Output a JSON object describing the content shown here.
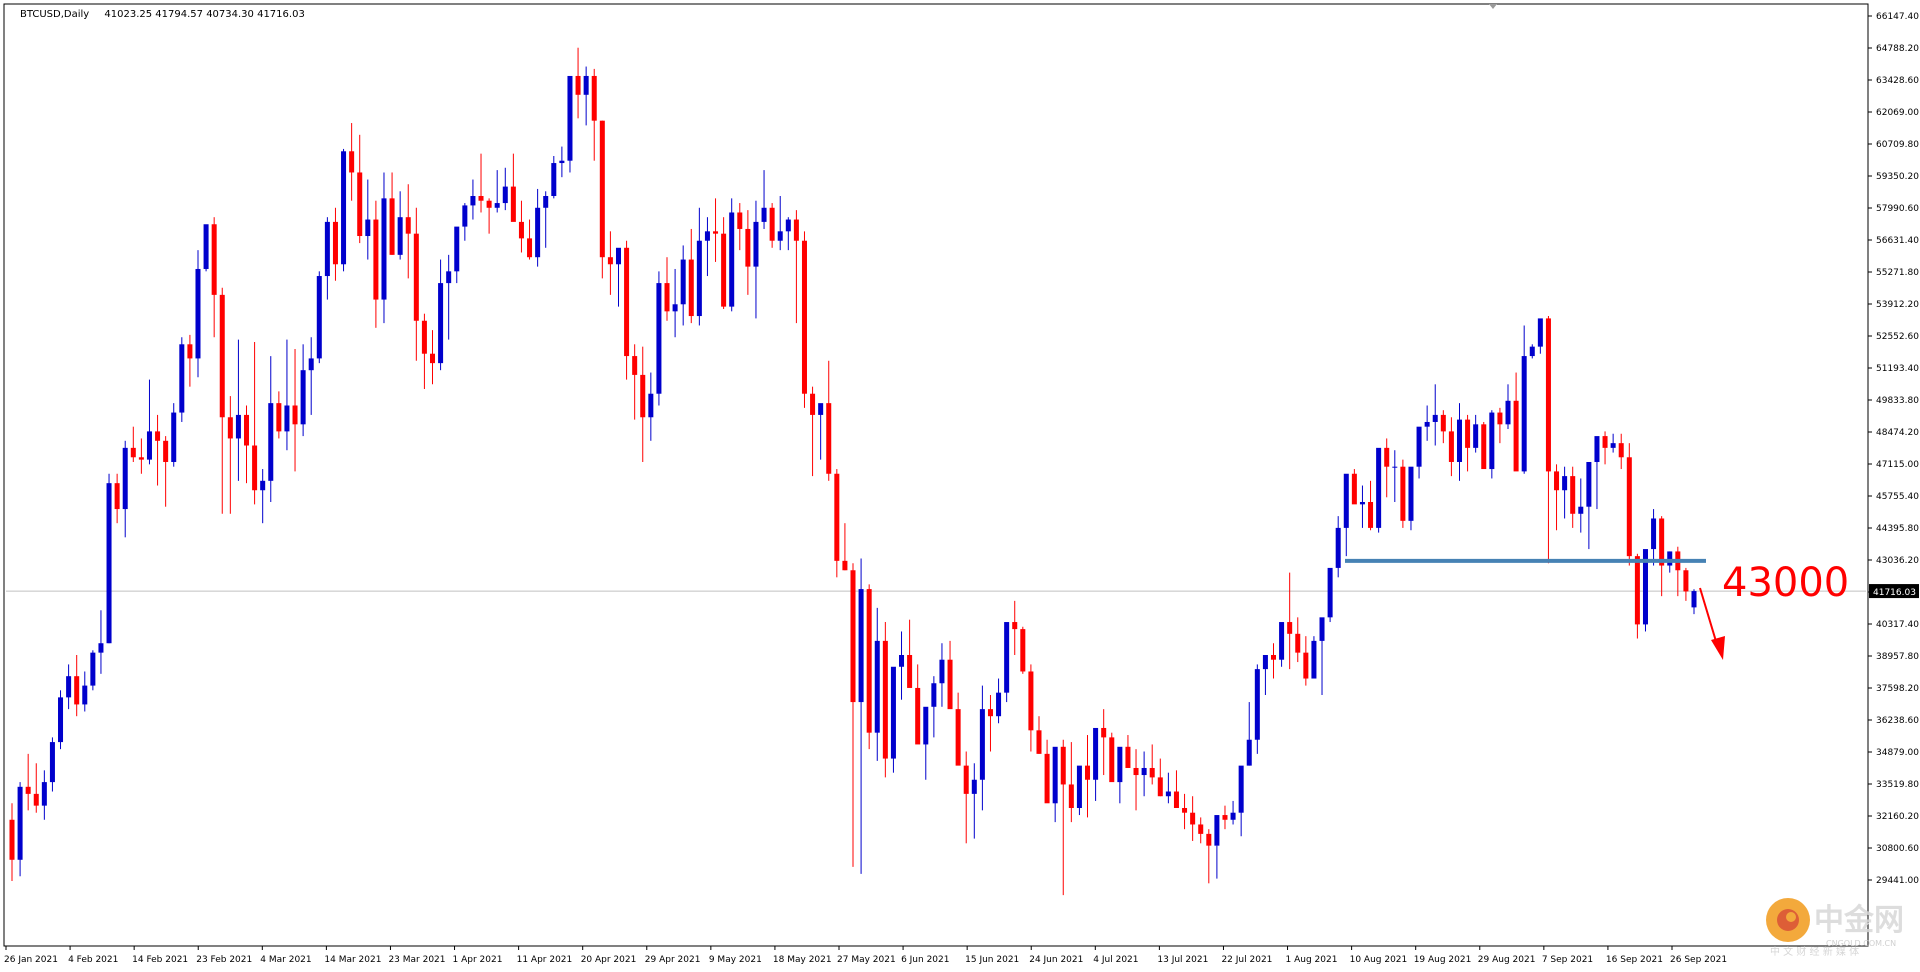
{
  "header": {
    "symbol": "BTCUSD,Daily",
    "ohlc": "41023.25 41794.57 40734.30 41716.03"
  },
  "colors": {
    "bull": "#0000cc",
    "bear": "#ff0000",
    "level_line": "#4682b4",
    "annotation": "#ff0000",
    "axis": "#000000",
    "price_tag_bg": "#000000"
  },
  "annotation": {
    "text": "43000"
  },
  "watermark": {
    "text": "中金网",
    "subtext": "CNGOLD.COM.CN",
    "tagline": "中 文 财 经 新 媒 体"
  },
  "chart_data": {
    "type": "candlestick",
    "title": "BTCUSD,Daily",
    "ylim": [
      28600,
      67500
    ],
    "price_ticks": [
      "66147.40",
      "64788.20",
      "63428.60",
      "62069.00",
      "60709.80",
      "59350.20",
      "57990.60",
      "56631.40",
      "55271.80",
      "53912.20",
      "52552.60",
      "51193.40",
      "49833.80",
      "48474.20",
      "47115.00",
      "45755.40",
      "44395.80",
      "43036.20",
      "41676.60",
      "40317.40",
      "38957.80",
      "37598.20",
      "36238.60",
      "34879.00",
      "33519.80",
      "32160.20",
      "30800.60",
      "29441.00"
    ],
    "current_price": "41716.03",
    "date_labels": [
      "26 Jan 2021",
      "4 Feb 2021",
      "14 Feb 2021",
      "23 Feb 2021",
      "4 Mar 2021",
      "14 Mar 2021",
      "23 Mar 2021",
      "1 Apr 2021",
      "11 Apr 2021",
      "20 Apr 2021",
      "29 Apr 2021",
      "9 May 2021",
      "18 May 2021",
      "27 May 2021",
      "6 Jun 2021",
      "15 Jun 2021",
      "24 Jun 2021",
      "4 Jul 2021",
      "13 Jul 2021",
      "22 Jul 2021",
      "1 Aug 2021",
      "10 Aug 2021",
      "19 Aug 2021",
      "29 Aug 2021",
      "7 Sep 2021",
      "16 Sep 2021",
      "26 Sep 2021"
    ],
    "horizontal_level": 43000,
    "candles": [
      [
        32000,
        32700,
        29400,
        30300
      ],
      [
        30300,
        33600,
        29600,
        33400
      ],
      [
        33400,
        34800,
        32400,
        33100
      ],
      [
        33100,
        34400,
        32300,
        32600
      ],
      [
        32600,
        34100,
        32000,
        33600
      ],
      [
        33600,
        35500,
        33200,
        35300
      ],
      [
        35300,
        37500,
        35000,
        37200
      ],
      [
        37200,
        38600,
        36700,
        38100
      ],
      [
        38100,
        39000,
        36400,
        36900
      ],
      [
        36900,
        38300,
        36600,
        37700
      ],
      [
        37700,
        39200,
        37500,
        39100
      ],
      [
        39100,
        40900,
        38200,
        39500
      ],
      [
        39500,
        46700,
        39500,
        46300
      ],
      [
        46300,
        46700,
        44600,
        45200
      ],
      [
        45200,
        48100,
        44000,
        47800
      ],
      [
        47800,
        48700,
        47200,
        47400
      ],
      [
        47400,
        48200,
        46700,
        47300
      ],
      [
        47300,
        50700,
        47100,
        48500
      ],
      [
        48500,
        49200,
        46200,
        48100
      ],
      [
        48100,
        48300,
        45300,
        47200
      ],
      [
        47200,
        49700,
        47000,
        49300
      ],
      [
        49300,
        52500,
        48900,
        52200
      ],
      [
        52200,
        52600,
        50400,
        51600
      ],
      [
        51600,
        56200,
        50800,
        55400
      ],
      [
        55400,
        57200,
        55300,
        57300
      ],
      [
        57300,
        57600,
        52500,
        54300
      ],
      [
        54300,
        54600,
        45000,
        49100
      ],
      [
        49100,
        50000,
        45000,
        48200
      ],
      [
        48200,
        52400,
        46400,
        49200
      ],
      [
        49200,
        49600,
        46300,
        47900
      ],
      [
        47900,
        52300,
        45400,
        46000
      ],
      [
        46000,
        46900,
        44600,
        46400
      ],
      [
        46400,
        51700,
        45500,
        49700
      ],
      [
        49700,
        50200,
        48200,
        48500
      ],
      [
        48500,
        52400,
        47700,
        49600
      ],
      [
        49600,
        52000,
        46800,
        48800
      ],
      [
        48800,
        52200,
        48300,
        51100
      ],
      [
        51100,
        52500,
        49200,
        51600
      ],
      [
        51600,
        55300,
        51400,
        55100
      ],
      [
        55100,
        57600,
        54100,
        57400
      ],
      [
        57400,
        58000,
        54900,
        55600
      ],
      [
        55600,
        60500,
        55300,
        60400
      ],
      [
        60400,
        61600,
        58300,
        59500
      ],
      [
        59500,
        61100,
        56500,
        56800
      ],
      [
        56800,
        59200,
        55800,
        57500
      ],
      [
        57500,
        58300,
        52900,
        54100
      ],
      [
        54100,
        59500,
        53100,
        58400
      ],
      [
        58400,
        59500,
        56000,
        56000
      ],
      [
        56000,
        58700,
        55800,
        57600
      ],
      [
        57600,
        59000,
        55000,
        56900
      ],
      [
        56900,
        58000,
        51500,
        53200
      ],
      [
        53200,
        53500,
        50300,
        51800
      ],
      [
        51800,
        52800,
        50500,
        51400
      ],
      [
        51400,
        55800,
        51100,
        54800
      ],
      [
        54800,
        56000,
        52400,
        55300
      ],
      [
        55300,
        57000,
        54800,
        57200
      ],
      [
        57200,
        58200,
        56600,
        58100
      ],
      [
        58100,
        59200,
        57500,
        58500
      ],
      [
        58500,
        60300,
        57800,
        58300
      ],
      [
        58300,
        58400,
        56900,
        58000
      ],
      [
        58000,
        59600,
        57800,
        58200
      ],
      [
        58200,
        59700,
        57900,
        58900
      ],
      [
        58900,
        60300,
        58300,
        57400
      ],
      [
        57400,
        58300,
        56100,
        56700
      ],
      [
        56700,
        57500,
        55800,
        55900
      ],
      [
        55900,
        58800,
        55500,
        58000
      ],
      [
        58000,
        58700,
        56300,
        58500
      ],
      [
        58500,
        60200,
        58400,
        59900
      ],
      [
        59900,
        60600,
        59300,
        60000
      ],
      [
        60000,
        62300,
        59500,
        63600
      ],
      [
        63600,
        64800,
        61800,
        62800
      ],
      [
        62800,
        64000,
        61500,
        63600
      ],
      [
        63600,
        63900,
        60000,
        61700
      ],
      [
        61700,
        61700,
        55000,
        55900
      ],
      [
        55900,
        57000,
        54300,
        55600
      ],
      [
        55600,
        56000,
        53800,
        56300
      ],
      [
        56300,
        56600,
        50700,
        51700
      ],
      [
        51700,
        52200,
        49000,
        50900
      ],
      [
        50900,
        52100,
        47200,
        49100
      ],
      [
        49100,
        51000,
        48100,
        50100
      ],
      [
        50100,
        55300,
        49600,
        54800
      ],
      [
        54800,
        55900,
        53200,
        53600
      ],
      [
        53600,
        55400,
        52500,
        53900
      ],
      [
        53900,
        56400,
        53000,
        55800
      ],
      [
        55800,
        57100,
        53100,
        53400
      ],
      [
        53400,
        58000,
        53000,
        56600
      ],
      [
        56600,
        57600,
        55100,
        57000
      ],
      [
        57000,
        58400,
        55700,
        56900
      ],
      [
        56900,
        57600,
        53700,
        53800
      ],
      [
        53800,
        58400,
        53600,
        57800
      ],
      [
        57800,
        58200,
        56200,
        57100
      ],
      [
        57100,
        57900,
        54300,
        55500
      ],
      [
        55500,
        58300,
        53300,
        57400
      ],
      [
        57400,
        59600,
        57100,
        58000
      ],
      [
        58000,
        58200,
        56300,
        56600
      ],
      [
        56600,
        58500,
        56200,
        57000
      ],
      [
        57000,
        57600,
        56200,
        57500
      ],
      [
        57500,
        57900,
        53100,
        56600
      ],
      [
        56600,
        57000,
        49500,
        50100
      ],
      [
        50100,
        50400,
        46600,
        49200
      ],
      [
        49200,
        49600,
        47300,
        49700
      ],
      [
        49700,
        51500,
        46400,
        46700
      ],
      [
        46700,
        46900,
        42300,
        43000
      ],
      [
        43000,
        44600,
        42600,
        42600
      ],
      [
        42600,
        42900,
        30000,
        37000
      ],
      [
        37000,
        43100,
        29700,
        41800
      ],
      [
        41800,
        42000,
        35000,
        35700
      ],
      [
        35700,
        41000,
        34500,
        39600
      ],
      [
        39600,
        40400,
        33800,
        34600
      ],
      [
        34600,
        37800,
        34000,
        38500
      ],
      [
        38500,
        40000,
        37100,
        39000
      ],
      [
        39000,
        40500,
        37700,
        37600
      ],
      [
        37600,
        38600,
        35400,
        35200
      ],
      [
        35200,
        36000,
        33700,
        36800
      ],
      [
        36800,
        38100,
        35500,
        37800
      ],
      [
        37800,
        39500,
        36800,
        38800
      ],
      [
        38800,
        39600,
        37200,
        36700
      ],
      [
        36700,
        37400,
        34900,
        34300
      ],
      [
        34300,
        34900,
        31000,
        33100
      ],
      [
        33100,
        34400,
        31200,
        33700
      ],
      [
        33700,
        37700,
        32400,
        36700
      ],
      [
        36700,
        37300,
        34900,
        36400
      ],
      [
        36400,
        38000,
        36100,
        37400
      ],
      [
        37400,
        40000,
        37000,
        40400
      ],
      [
        40400,
        41300,
        39000,
        40100
      ],
      [
        40100,
        40200,
        38200,
        38300
      ],
      [
        38300,
        38600,
        34900,
        35800
      ],
      [
        35800,
        36400,
        34800,
        34800
      ],
      [
        34800,
        35400,
        33000,
        32700
      ],
      [
        32700,
        34900,
        31900,
        35100
      ],
      [
        35100,
        35400,
        28800,
        33500
      ],
      [
        33500,
        35300,
        31900,
        32500
      ],
      [
        32500,
        33800,
        32200,
        34300
      ],
      [
        34300,
        35600,
        32100,
        33700
      ],
      [
        33700,
        35700,
        32800,
        35900
      ],
      [
        35900,
        36700,
        33900,
        35500
      ],
      [
        35500,
        35700,
        33700,
        33600
      ],
      [
        33600,
        34100,
        32700,
        35100
      ],
      [
        35100,
        35600,
        34300,
        34200
      ],
      [
        34200,
        35000,
        32400,
        33900
      ],
      [
        33900,
        34900,
        33000,
        34200
      ],
      [
        34200,
        35200,
        33500,
        33800
      ],
      [
        33800,
        34600,
        33000,
        33000
      ],
      [
        33000,
        34000,
        32700,
        33200
      ],
      [
        33200,
        34100,
        32500,
        32500
      ],
      [
        32500,
        33100,
        31600,
        32300
      ],
      [
        32300,
        33000,
        31100,
        31800
      ],
      [
        31800,
        32100,
        31000,
        31400
      ],
      [
        31400,
        31600,
        29300,
        30900
      ],
      [
        30900,
        30900,
        29500,
        32200
      ],
      [
        32200,
        32600,
        31600,
        32000
      ],
      [
        32000,
        32800,
        31800,
        32300
      ],
      [
        32300,
        33400,
        31300,
        34300
      ],
      [
        34300,
        37000,
        34300,
        35400
      ],
      [
        35400,
        38600,
        34800,
        38400
      ],
      [
        38400,
        38900,
        37300,
        39000
      ],
      [
        39000,
        39500,
        38000,
        38800
      ],
      [
        38800,
        40300,
        38500,
        40400
      ],
      [
        40400,
        42500,
        38400,
        39900
      ],
      [
        39900,
        40600,
        38700,
        39100
      ],
      [
        39100,
        39800,
        37700,
        38000
      ],
      [
        38000,
        39800,
        38100,
        39600
      ],
      [
        39600,
        40300,
        37300,
        40600
      ],
      [
        40600,
        41400,
        40400,
        42700
      ],
      [
        42700,
        44900,
        42300,
        44400
      ],
      [
        44400,
        45400,
        43200,
        46700
      ],
      [
        46700,
        46900,
        45500,
        45400
      ],
      [
        45400,
        46200,
        44400,
        45500
      ],
      [
        45500,
        46400,
        44300,
        44400
      ],
      [
        44400,
        45600,
        44200,
        47800
      ],
      [
        47800,
        48200,
        45700,
        47000
      ],
      [
        47000,
        47700,
        45500,
        47000
      ],
      [
        47000,
        47300,
        44400,
        44700
      ],
      [
        44700,
        46800,
        44300,
        47000
      ],
      [
        47000,
        48500,
        46500,
        48700
      ],
      [
        48700,
        49600,
        48100,
        48900
      ],
      [
        48900,
        50500,
        47900,
        49200
      ],
      [
        49200,
        49400,
        48000,
        48500
      ],
      [
        48500,
        49100,
        46600,
        47200
      ],
      [
        47200,
        49700,
        46400,
        49000
      ],
      [
        49000,
        49200,
        46800,
        47800
      ],
      [
        47800,
        49200,
        47600,
        48800
      ],
      [
        48800,
        48900,
        47600,
        46900
      ],
      [
        46900,
        49400,
        46500,
        49300
      ],
      [
        49300,
        49500,
        48000,
        48800
      ],
      [
        48800,
        50500,
        48600,
        49800
      ],
      [
        49800,
        51000,
        47600,
        46800
      ],
      [
        46800,
        53000,
        46700,
        51700
      ],
      [
        51700,
        52200,
        51600,
        52100
      ],
      [
        52100,
        52800,
        51800,
        53300
      ],
      [
        53300,
        53400,
        42900,
        46800
      ],
      [
        46800,
        47100,
        44300,
        46000
      ],
      [
        46000,
        47000,
        44800,
        46600
      ],
      [
        46600,
        47000,
        44400,
        45000
      ],
      [
        45000,
        46500,
        44200,
        45300
      ],
      [
        45300,
        45900,
        43500,
        47200
      ],
      [
        47200,
        48100,
        45200,
        48300
      ],
      [
        48300,
        48500,
        47100,
        47800
      ],
      [
        47800,
        48400,
        47600,
        48000
      ],
      [
        48000,
        48400,
        46900,
        47400
      ],
      [
        47400,
        48000,
        42800,
        43200
      ],
      [
        43200,
        43300,
        39700,
        40300
      ],
      [
        40300,
        42500,
        40000,
        43500
      ],
      [
        43500,
        45200,
        42800,
        44800
      ],
      [
        44800,
        44900,
        41500,
        42800
      ],
      [
        42800,
        43400,
        42500,
        43400
      ],
      [
        43400,
        43600,
        41500,
        42600
      ],
      [
        42600,
        42700,
        41300,
        41700
      ],
      [
        41023,
        41795,
        40734,
        41716
      ]
    ]
  }
}
